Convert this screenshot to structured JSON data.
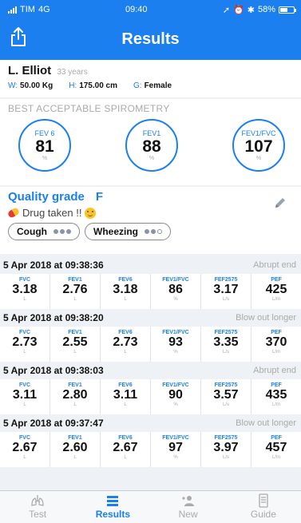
{
  "status": {
    "carrier": "TIM",
    "network": "4G",
    "time": "09:40",
    "battery": "58%",
    "battery_level": 0.58
  },
  "header": {
    "title": "Results"
  },
  "patient": {
    "name": "L. Elliot",
    "age": "33 years",
    "weight_label": "W:",
    "weight": "50.00 Kg",
    "height_label": "H:",
    "height": "175.00 cm",
    "gender_label": "G:",
    "gender": "Female"
  },
  "best": {
    "title": "BEST ACCEPTABLE SPIROMETRY",
    "metrics": [
      {
        "label": "FEV 6",
        "value": "81",
        "unit": "%"
      },
      {
        "label": "FEV1",
        "value": "88",
        "unit": "%"
      },
      {
        "label": "FEV1/FVC",
        "value": "107",
        "unit": "%"
      }
    ]
  },
  "quality": {
    "label": "Quality grade",
    "grade": "F",
    "drug": "Drug taken !!",
    "chips": [
      {
        "label": "Cough",
        "level": 3
      },
      {
        "label": "Wheezing",
        "level": 2
      }
    ]
  },
  "trials": [
    {
      "date": "5 Apr 2018 at 09:38:36",
      "note": "Abrupt end",
      "values": [
        {
          "label": "FVC",
          "value": "3.18",
          "unit": "L"
        },
        {
          "label": "FEV1",
          "value": "2.76",
          "unit": "L"
        },
        {
          "label": "FEV6",
          "value": "3.18",
          "unit": "L"
        },
        {
          "label": "FEV1/FVC",
          "value": "86",
          "unit": "%"
        },
        {
          "label": "FEF2575",
          "value": "3.17",
          "unit": "L/s"
        },
        {
          "label": "PEF",
          "value": "425",
          "unit": "L/m"
        }
      ]
    },
    {
      "date": "5 Apr 2018 at 09:38:20",
      "note": "Blow out longer",
      "values": [
        {
          "label": "FVC",
          "value": "2.73",
          "unit": "L"
        },
        {
          "label": "FEV1",
          "value": "2.55",
          "unit": "L"
        },
        {
          "label": "FEV6",
          "value": "2.73",
          "unit": "L"
        },
        {
          "label": "FEV1/FVC",
          "value": "93",
          "unit": "%"
        },
        {
          "label": "FEF2575",
          "value": "3.35",
          "unit": "L/s"
        },
        {
          "label": "PEF",
          "value": "370",
          "unit": "L/m"
        }
      ]
    },
    {
      "date": "5 Apr 2018 at 09:38:03",
      "note": "Abrupt end",
      "values": [
        {
          "label": "FVC",
          "value": "3.11",
          "unit": "L"
        },
        {
          "label": "FEV1",
          "value": "2.80",
          "unit": "L"
        },
        {
          "label": "FEV6",
          "value": "3.11",
          "unit": "L"
        },
        {
          "label": "FEV1/FVC",
          "value": "90",
          "unit": "%"
        },
        {
          "label": "FEF2575",
          "value": "3.57",
          "unit": "L/s"
        },
        {
          "label": "PEF",
          "value": "435",
          "unit": "L/m"
        }
      ]
    },
    {
      "date": "5 Apr 2018 at 09:37:47",
      "note": "Blow out longer",
      "values": [
        {
          "label": "FVC",
          "value": "2.67",
          "unit": "L"
        },
        {
          "label": "FEV1",
          "value": "2.60",
          "unit": "L"
        },
        {
          "label": "FEV6",
          "value": "2.67",
          "unit": "L"
        },
        {
          "label": "FEV1/FVC",
          "value": "97",
          "unit": "%"
        },
        {
          "label": "FEF2575",
          "value": "3.97",
          "unit": "L/s"
        },
        {
          "label": "PEF",
          "value": "457",
          "unit": "L/m"
        }
      ]
    }
  ],
  "tabs": [
    {
      "label": "Test",
      "icon": "lungs-icon",
      "active": false
    },
    {
      "label": "Results",
      "icon": "list-icon",
      "active": true
    },
    {
      "label": "New",
      "icon": "add-user-icon",
      "active": false
    },
    {
      "label": "Guide",
      "icon": "document-icon",
      "active": false
    }
  ],
  "colors": {
    "primary": "#1b7ff0",
    "muted": "#aaaaaa",
    "background": "#eef1f5"
  }
}
